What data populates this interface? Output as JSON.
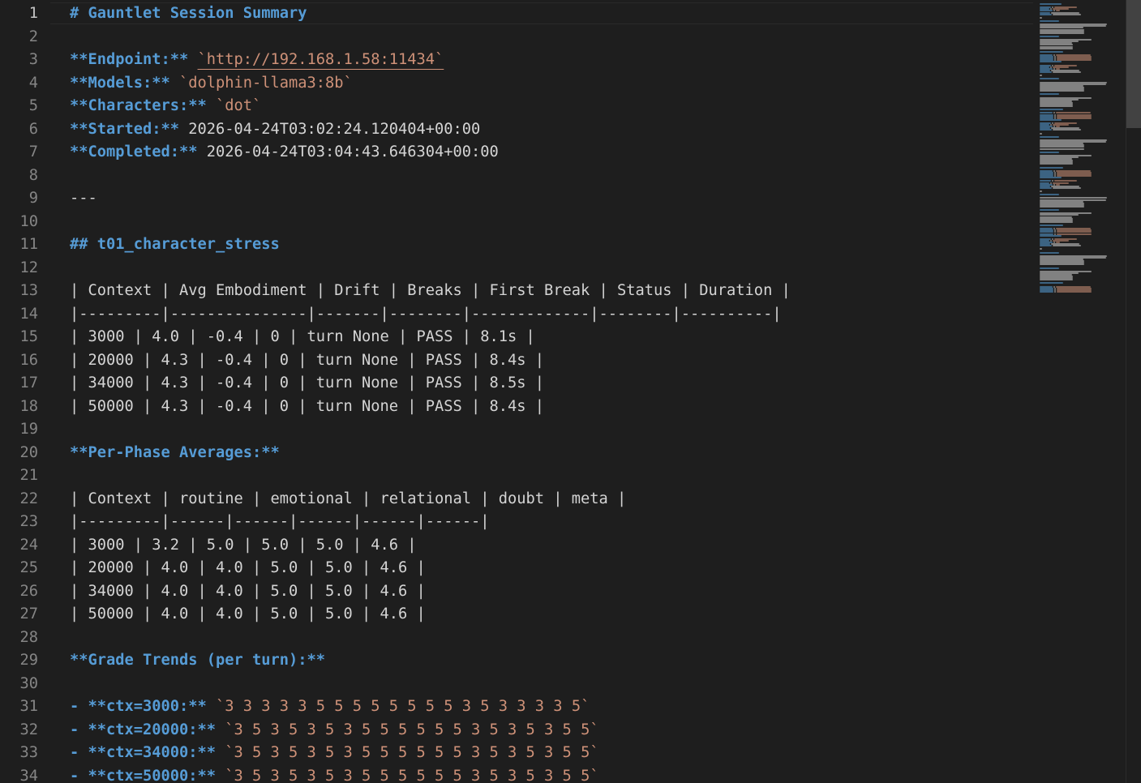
{
  "editor": {
    "lines": [
      [
        {
          "t": "# Gauntlet Session Summary",
          "s": "h"
        }
      ],
      [],
      [
        {
          "t": "**Endpoint:**",
          "s": "b"
        },
        {
          "t": " ",
          "s": "t"
        },
        {
          "t": "`http://192.168.1.58:11434`",
          "s": "c",
          "link": true
        }
      ],
      [
        {
          "t": "**Models:**",
          "s": "b"
        },
        {
          "t": " ",
          "s": "t"
        },
        {
          "t": "`dolphin-llama3:8b`",
          "s": "c"
        }
      ],
      [
        {
          "t": "**Characters:**",
          "s": "b"
        },
        {
          "t": " ",
          "s": "t"
        },
        {
          "t": "`dot`",
          "s": "c"
        }
      ],
      [
        {
          "t": "**Started:**",
          "s": "b"
        },
        {
          "t": " 2026-04-24T03:02:24.120404+00:00",
          "s": "t"
        }
      ],
      [
        {
          "t": "**Completed:**",
          "s": "b"
        },
        {
          "t": " 2026-04-24T03:04:43.646304+00:00",
          "s": "t"
        }
      ],
      [],
      [
        {
          "t": "---",
          "s": "t"
        }
      ],
      [],
      [
        {
          "t": "## t01_character_stress",
          "s": "h"
        }
      ],
      [],
      [
        {
          "t": "| Context | Avg Embodiment | Drift | Breaks | First Break | Status | Duration |",
          "s": "t"
        }
      ],
      [
        {
          "t": "|---------|---------------|-------|--------|-------------|--------|----------|",
          "s": "t"
        }
      ],
      [
        {
          "t": "| 3000 | 4.0 | -0.4 | 0 | turn None | PASS | 8.1s |",
          "s": "t"
        }
      ],
      [
        {
          "t": "| 20000 | 4.3 | -0.4 | 0 | turn None | PASS | 8.4s |",
          "s": "t"
        }
      ],
      [
        {
          "t": "| 34000 | 4.3 | -0.4 | 0 | turn None | PASS | 8.5s |",
          "s": "t"
        }
      ],
      [
        {
          "t": "| 50000 | 4.3 | -0.4 | 0 | turn None | PASS | 8.4s |",
          "s": "t"
        }
      ],
      [],
      [
        {
          "t": "**Per-Phase Averages:**",
          "s": "b"
        }
      ],
      [],
      [
        {
          "t": "| Context | routine | emotional | relational | doubt | meta |",
          "s": "t"
        }
      ],
      [
        {
          "t": "|---------|------|------|------|------|------|",
          "s": "t"
        }
      ],
      [
        {
          "t": "| 3000 | 3.2 | 5.0 | 5.0 | 5.0 | 4.6 |",
          "s": "t"
        }
      ],
      [
        {
          "t": "| 20000 | 4.0 | 4.0 | 5.0 | 5.0 | 4.6 |",
          "s": "t"
        }
      ],
      [
        {
          "t": "| 34000 | 4.0 | 4.0 | 5.0 | 5.0 | 4.6 |",
          "s": "t"
        }
      ],
      [
        {
          "t": "| 50000 | 4.0 | 4.0 | 5.0 | 5.0 | 4.6 |",
          "s": "t"
        }
      ],
      [],
      [
        {
          "t": "**Grade Trends (per turn):**",
          "s": "b"
        }
      ],
      [],
      [
        {
          "t": "- **ctx=3000:**",
          "s": "b"
        },
        {
          "t": " ",
          "s": "t"
        },
        {
          "t": "`3 3 3 3 3 5 5 5 5 5 5 5 5 3 5 3 3 3 3 5`",
          "s": "c"
        }
      ],
      [
        {
          "t": "- **ctx=20000:**",
          "s": "b"
        },
        {
          "t": " ",
          "s": "t"
        },
        {
          "t": "`3 5 3 5 3 5 3 5 5 5 5 5 5 3 5 3 5 3 5 5`",
          "s": "c"
        }
      ],
      [
        {
          "t": "- **ctx=34000:**",
          "s": "b"
        },
        {
          "t": " ",
          "s": "t"
        },
        {
          "t": "`3 5 3 5 3 5 3 5 5 5 5 5 5 3 5 3 5 3 5 5`",
          "s": "c"
        }
      ],
      [
        {
          "t": "- **ctx=50000:**",
          "s": "b"
        },
        {
          "t": " ",
          "s": "t"
        },
        {
          "t": "`3 5 3 5 3 5 3 5 5 5 5 5 5 3 5 3 5 3 5 5`",
          "s": "c"
        }
      ]
    ],
    "active_line": 1
  },
  "colors": {
    "background": "#1e1e1e",
    "heading": "#569cd6",
    "inline_code": "#ce9178",
    "text": "#d4d4d4",
    "line_number": "#858585"
  }
}
